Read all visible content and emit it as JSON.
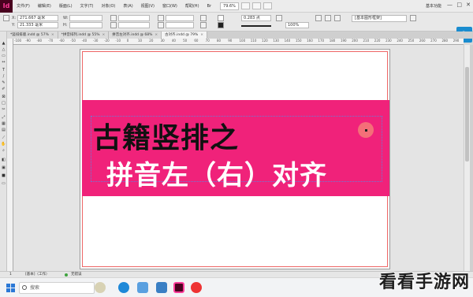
{
  "menubar": {
    "logo": "Id",
    "items": [
      "文件(F)",
      "编辑(E)",
      "版面(L)",
      "文字(T)",
      "对象(O)",
      "表(A)",
      "视图(V)",
      "窗口(W)",
      "帮助(H)"
    ],
    "bridge": "Br",
    "zoom": "79.6%",
    "workspace": "基本功能",
    "win_min": "—",
    "win_max": "□",
    "win_close": "✕"
  },
  "controlbar": {
    "x_label": "X:",
    "x_value": "271.667 毫米",
    "y_label": "Y:",
    "y_value": "21.333 毫米",
    "w_label": "W:",
    "w_value": "",
    "h_label": "H:",
    "h_value": "",
    "stroke_weight": "0.283 点",
    "percent": "100%",
    "frame_style": "[基本图形框架]",
    "share_icon": "share-icon"
  },
  "tabs": [
    {
      "label": "*竖排排版.indd @ 57%"
    },
    {
      "label": "*拼音排列.indd @ 55%"
    },
    {
      "label": "拼音左对齐.indd @ 68%"
    },
    {
      "label": "古对齐.indd @ 79%"
    }
  ],
  "ruler": {
    "ticks": [
      "-100",
      "-90",
      "-80",
      "-70",
      "-60",
      "-50",
      "-40",
      "-30",
      "-20",
      "-10",
      "0",
      "10",
      "20",
      "30",
      "40",
      "50",
      "60",
      "70",
      "80",
      "90",
      "100",
      "110",
      "120",
      "130",
      "140",
      "150",
      "160",
      "170",
      "180",
      "190",
      "200",
      "210",
      "220",
      "230",
      "240",
      "250",
      "260",
      "270",
      "280",
      "290"
    ]
  },
  "document": {
    "line1": "古籍竖排之",
    "line2": "拼音左（右）对齐",
    "banner_color": "#f0227a"
  },
  "statusbar": {
    "page": "1",
    "mode": "[基本]（工作）",
    "errors": "无错误"
  },
  "taskbar": {
    "search_placeholder": "搜索"
  },
  "watermark": "看看手游网"
}
